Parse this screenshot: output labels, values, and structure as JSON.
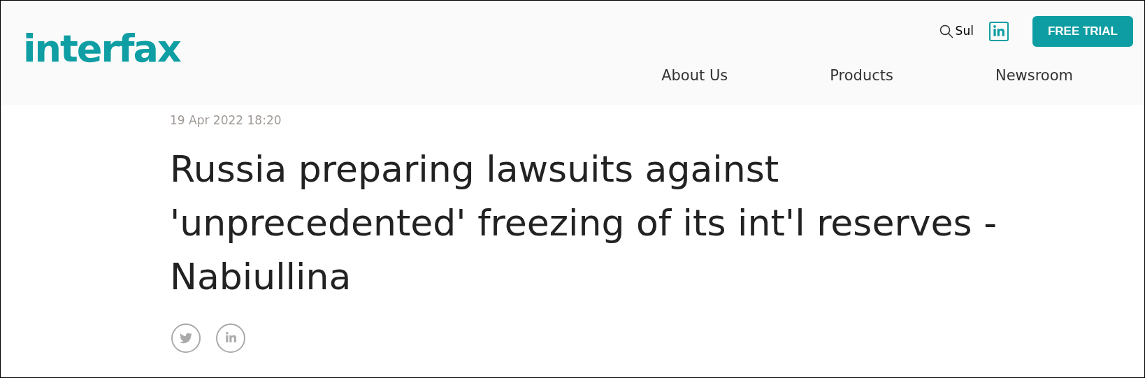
{
  "logo": {
    "text": "interfax"
  },
  "header": {
    "search_text": "Sul",
    "button": "FREE TRIAL"
  },
  "nav": [
    {
      "label": "About Us"
    },
    {
      "label": "Products"
    },
    {
      "label": "Newsroom"
    }
  ],
  "article": {
    "date": "19 Apr 2022 18:20",
    "title": "Russia preparing lawsuits against 'unprecedented' freezing of its int'l reserves - Nabiullina"
  }
}
